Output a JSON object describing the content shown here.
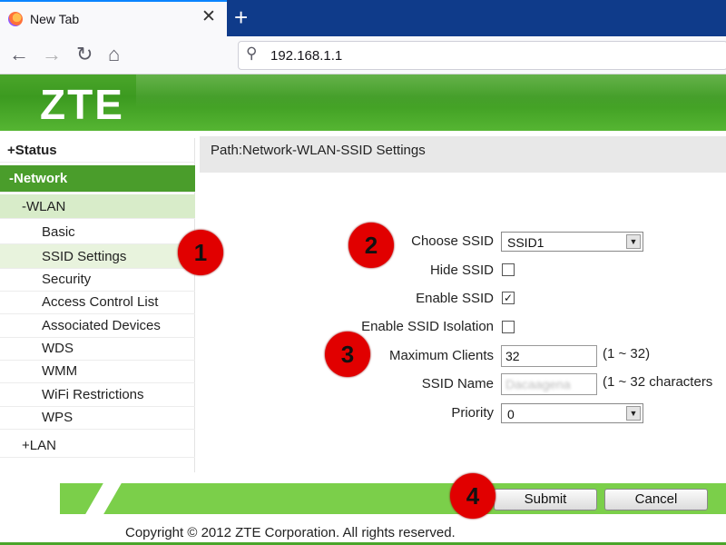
{
  "browser": {
    "tab_title": "New Tab",
    "tab_close": "✕",
    "new_tab": "+",
    "url": "192.168.1.1"
  },
  "header": {
    "logo": "ZTE"
  },
  "sidebar": {
    "status": "+Status",
    "network": "-Network",
    "wlan": "-WLAN",
    "items": [
      "Basic",
      "SSID Settings",
      "Security",
      "Access Control List",
      "Associated Devices",
      "WDS",
      "WMM",
      "WiFi Restrictions",
      "WPS"
    ],
    "active_item": "SSID Settings",
    "lan": "+LAN"
  },
  "main": {
    "path": "Path:Network-WLAN-SSID Settings",
    "choose_ssid": {
      "label": "Choose SSID",
      "value": "SSID1"
    },
    "hide_ssid": {
      "label": "Hide SSID",
      "checked": false
    },
    "enable_ssid": {
      "label": "Enable SSID",
      "checked": true,
      "check_glyph": "✓"
    },
    "ssid_isolation": {
      "label": "Enable SSID Isolation",
      "checked": false
    },
    "max_clients": {
      "label": "Maximum Clients",
      "value": "32",
      "hint": "(1 ~ 32)"
    },
    "ssid_name": {
      "label": "SSID Name",
      "value": "Dacaagena",
      "hint": "(1 ~ 32 characters"
    },
    "priority": {
      "label": "Priority",
      "value": "0"
    }
  },
  "buttons": {
    "submit": "Submit",
    "cancel": "Cancel"
  },
  "footer": {
    "copyright": "Copyright © 2012 ZTE Corporation. All rights reserved."
  },
  "annotations": [
    "1",
    "2",
    "3",
    "4"
  ],
  "colors": {
    "zte_green": "#4aa52a",
    "annotation_red": "#e10000",
    "footer_green": "#7bcf4a"
  }
}
